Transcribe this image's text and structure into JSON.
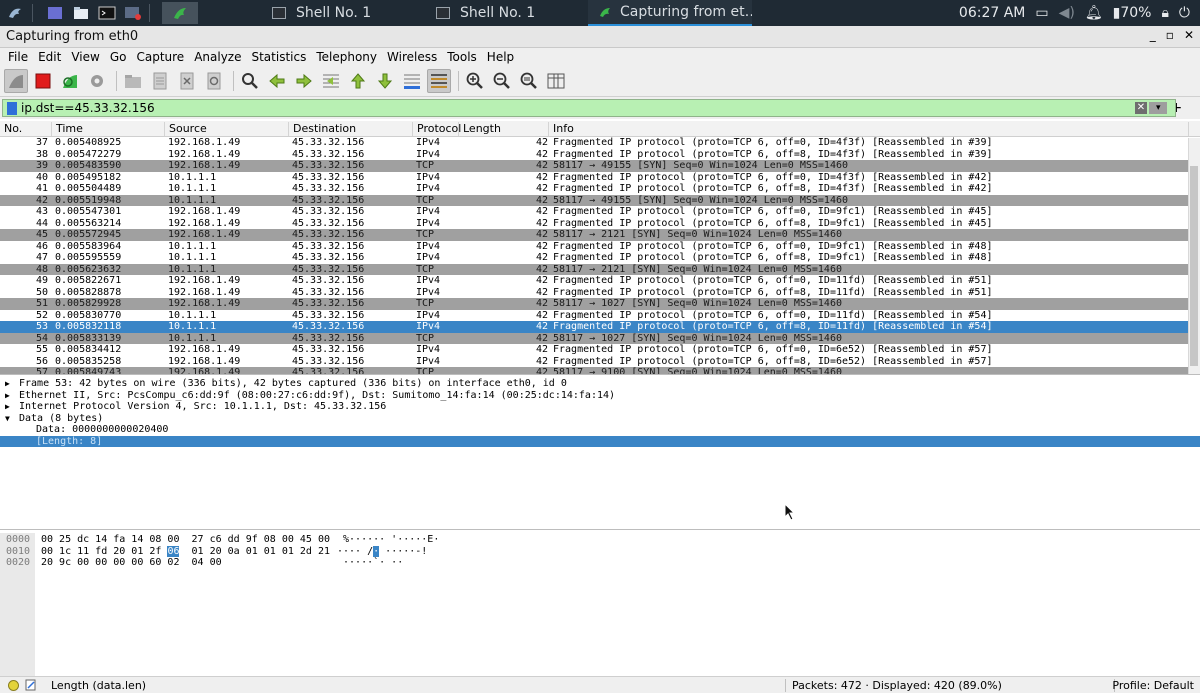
{
  "taskbar": {
    "tasks": [
      {
        "label": "Shell No. 1"
      },
      {
        "label": "Shell No. 1"
      },
      {
        "label": "Capturing from et…"
      }
    ],
    "clock": "06:27 AM",
    "battery": "70%"
  },
  "window": {
    "title": "Capturing from eth0",
    "controls": [
      "_",
      "▫",
      "✕"
    ]
  },
  "menu": [
    "File",
    "Edit",
    "View",
    "Go",
    "Capture",
    "Analyze",
    "Statistics",
    "Telephony",
    "Wireless",
    "Tools",
    "Help"
  ],
  "filter": {
    "value": "ip.dst==45.33.32.156"
  },
  "packet_list": {
    "headers": [
      "No.",
      "Time",
      "Source",
      "Destination",
      "Protocol",
      "Length",
      "Info"
    ],
    "rows": [
      {
        "no": "37",
        "time": "0.005408925",
        "src": "192.168.1.49",
        "dst": "45.33.32.156",
        "proto": "IPv4",
        "len": "42",
        "info": "Fragmented IP protocol (proto=TCP 6, off=0, ID=4f3f) [Reassembled in #39]",
        "kind": "ipv4"
      },
      {
        "no": "38",
        "time": "0.005472279",
        "src": "192.168.1.49",
        "dst": "45.33.32.156",
        "proto": "IPv4",
        "len": "42",
        "info": "Fragmented IP protocol (proto=TCP 6, off=8, ID=4f3f) [Reassembled in #39]",
        "kind": "ipv4"
      },
      {
        "no": "39",
        "time": "0.005483590",
        "src": "192.168.1.49",
        "dst": "45.33.32.156",
        "proto": "TCP",
        "len": "42",
        "info": "58117 → 49155 [SYN] Seq=0 Win=1024 Len=0 MSS=1460",
        "kind": "tcp"
      },
      {
        "no": "40",
        "time": "0.005495182",
        "src": "10.1.1.1",
        "dst": "45.33.32.156",
        "proto": "IPv4",
        "len": "42",
        "info": "Fragmented IP protocol (proto=TCP 6, off=0, ID=4f3f) [Reassembled in #42]",
        "kind": "ipv4"
      },
      {
        "no": "41",
        "time": "0.005504489",
        "src": "10.1.1.1",
        "dst": "45.33.32.156",
        "proto": "IPv4",
        "len": "42",
        "info": "Fragmented IP protocol (proto=TCP 6, off=8, ID=4f3f) [Reassembled in #42]",
        "kind": "ipv4"
      },
      {
        "no": "42",
        "time": "0.005519948",
        "src": "10.1.1.1",
        "dst": "45.33.32.156",
        "proto": "TCP",
        "len": "42",
        "info": "58117 → 49155 [SYN] Seq=0 Win=1024 Len=0 MSS=1460",
        "kind": "tcp"
      },
      {
        "no": "43",
        "time": "0.005547301",
        "src": "192.168.1.49",
        "dst": "45.33.32.156",
        "proto": "IPv4",
        "len": "42",
        "info": "Fragmented IP protocol (proto=TCP 6, off=0, ID=9fc1) [Reassembled in #45]",
        "kind": "ipv4"
      },
      {
        "no": "44",
        "time": "0.005563214",
        "src": "192.168.1.49",
        "dst": "45.33.32.156",
        "proto": "IPv4",
        "len": "42",
        "info": "Fragmented IP protocol (proto=TCP 6, off=8, ID=9fc1) [Reassembled in #45]",
        "kind": "ipv4"
      },
      {
        "no": "45",
        "time": "0.005572945",
        "src": "192.168.1.49",
        "dst": "45.33.32.156",
        "proto": "TCP",
        "len": "42",
        "info": "58117 → 2121 [SYN] Seq=0 Win=1024 Len=0 MSS=1460",
        "kind": "tcp"
      },
      {
        "no": "46",
        "time": "0.005583964",
        "src": "10.1.1.1",
        "dst": "45.33.32.156",
        "proto": "IPv4",
        "len": "42",
        "info": "Fragmented IP protocol (proto=TCP 6, off=0, ID=9fc1) [Reassembled in #48]",
        "kind": "ipv4"
      },
      {
        "no": "47",
        "time": "0.005595559",
        "src": "10.1.1.1",
        "dst": "45.33.32.156",
        "proto": "IPv4",
        "len": "42",
        "info": "Fragmented IP protocol (proto=TCP 6, off=8, ID=9fc1) [Reassembled in #48]",
        "kind": "ipv4"
      },
      {
        "no": "48",
        "time": "0.005623632",
        "src": "10.1.1.1",
        "dst": "45.33.32.156",
        "proto": "TCP",
        "len": "42",
        "info": "58117 → 2121 [SYN] Seq=0 Win=1024 Len=0 MSS=1460",
        "kind": "tcp"
      },
      {
        "no": "49",
        "time": "0.005822671",
        "src": "192.168.1.49",
        "dst": "45.33.32.156",
        "proto": "IPv4",
        "len": "42",
        "info": "Fragmented IP protocol (proto=TCP 6, off=0, ID=11fd) [Reassembled in #51]",
        "kind": "ipv4"
      },
      {
        "no": "50",
        "time": "0.005828878",
        "src": "192.168.1.49",
        "dst": "45.33.32.156",
        "proto": "IPv4",
        "len": "42",
        "info": "Fragmented IP protocol (proto=TCP 6, off=8, ID=11fd) [Reassembled in #51]",
        "kind": "ipv4"
      },
      {
        "no": "51",
        "time": "0.005829928",
        "src": "192.168.1.49",
        "dst": "45.33.32.156",
        "proto": "TCP",
        "len": "42",
        "info": "58117 → 1027 [SYN] Seq=0 Win=1024 Len=0 MSS=1460",
        "kind": "tcp"
      },
      {
        "no": "52",
        "time": "0.005830770",
        "src": "10.1.1.1",
        "dst": "45.33.32.156",
        "proto": "IPv4",
        "len": "42",
        "info": "Fragmented IP protocol (proto=TCP 6, off=0, ID=11fd) [Reassembled in #54]",
        "kind": "ipv4"
      },
      {
        "no": "53",
        "time": "0.005832118",
        "src": "10.1.1.1",
        "dst": "45.33.32.156",
        "proto": "IPv4",
        "len": "42",
        "info": "Fragmented IP protocol (proto=TCP 6, off=8, ID=11fd) [Reassembled in #54]",
        "kind": "sel"
      },
      {
        "no": "54",
        "time": "0.005833139",
        "src": "10.1.1.1",
        "dst": "45.33.32.156",
        "proto": "TCP",
        "len": "42",
        "info": "58117 → 1027 [SYN] Seq=0 Win=1024 Len=0 MSS=1460",
        "kind": "tcp"
      },
      {
        "no": "55",
        "time": "0.005834412",
        "src": "192.168.1.49",
        "dst": "45.33.32.156",
        "proto": "IPv4",
        "len": "42",
        "info": "Fragmented IP protocol (proto=TCP 6, off=0, ID=6e52) [Reassembled in #57]",
        "kind": "ipv4"
      },
      {
        "no": "56",
        "time": "0.005835258",
        "src": "192.168.1.49",
        "dst": "45.33.32.156",
        "proto": "IPv4",
        "len": "42",
        "info": "Fragmented IP protocol (proto=TCP 6, off=8, ID=6e52) [Reassembled in #57]",
        "kind": "ipv4"
      },
      {
        "no": "57",
        "time": "0.005849743",
        "src": "192.168.1.49",
        "dst": "45.33.32.156",
        "proto": "TCP",
        "len": "42",
        "info": "58117 → 9100 [SYN] Seq=0 Win=1024 Len=0 MSS=1460",
        "kind": "tcp"
      }
    ]
  },
  "details": [
    {
      "text": "Frame 53: 42 bytes on wire (336 bits), 42 bytes captured (336 bits) on interface eth0, id 0",
      "arrow": "▶",
      "indent": 0,
      "selected": false
    },
    {
      "text": "Ethernet II, Src: PcsCompu_c6:dd:9f (08:00:27:c6:dd:9f), Dst: Sumitomo_14:fa:14 (00:25:dc:14:fa:14)",
      "arrow": "▶",
      "indent": 0,
      "selected": false
    },
    {
      "text": "Internet Protocol Version 4, Src: 10.1.1.1, Dst: 45.33.32.156",
      "arrow": "▶",
      "indent": 0,
      "selected": false
    },
    {
      "text": "Data (8 bytes)",
      "arrow": "▼",
      "indent": 0,
      "selected": false
    },
    {
      "text": "Data: 0000000000020400",
      "arrow": "",
      "indent": 1,
      "selected": false
    },
    {
      "text": "[Length: 8]",
      "arrow": "",
      "indent": 1,
      "selected": true
    }
  ],
  "bytes": [
    {
      "offset": "0000",
      "hex_pre": "00 25 dc 14 fa 14 08 00  27 c6 dd 9f 08 00 45 00",
      "hex_hl": "",
      "hex_post": "",
      "ascii_pre": " %······ '·····E·",
      "ascii_hl": "",
      "ascii_post": ""
    },
    {
      "offset": "0010",
      "hex_pre": "00 1c 11 fd 20 01 2f ",
      "hex_hl": "06",
      "hex_post": "  01 20 0a 01 01 01 2d 21",
      "ascii_pre": "···· /",
      "ascii_hl": "·",
      "ascii_post": " ·····-!"
    },
    {
      "offset": "0020",
      "hex_pre": "20 9c 00 00 00 00 60 02  04 00",
      "hex_hl": "",
      "hex_post": "",
      "ascii_pre": " ·····`· ··",
      "ascii_hl": "",
      "ascii_post": ""
    }
  ],
  "status": {
    "field": "Length (data.len)",
    "packets": "Packets: 472 · Displayed: 420 (89.0%)",
    "profile": "Profile: Default"
  }
}
